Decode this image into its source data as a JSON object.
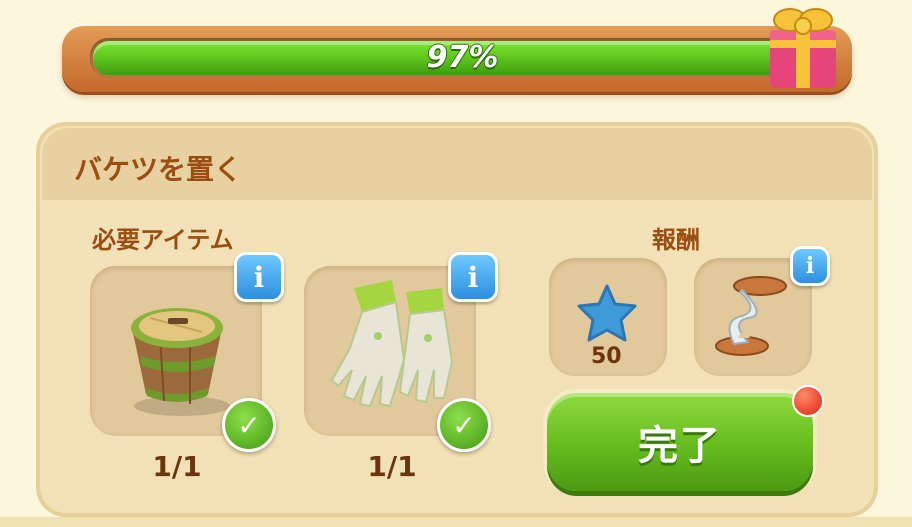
{
  "progress": {
    "percent_label": "97%",
    "fraction": 0.97
  },
  "quest": {
    "title": "バケツを置く"
  },
  "required": {
    "label": "必要アイテム",
    "items": [
      {
        "icon": "bucket-icon",
        "count": "1/1",
        "info": "i"
      },
      {
        "icon": "gloves-icon",
        "count": "1/1",
        "info": "i"
      }
    ]
  },
  "rewards": {
    "label": "報酬",
    "items": [
      {
        "icon": "blue-star-icon",
        "count": "50"
      },
      {
        "icon": "hourglass-icon",
        "info": "i"
      }
    ]
  },
  "complete_button": {
    "label": "完了"
  },
  "colors": {
    "accent_green": "#62b81c",
    "title_brown": "#9a4e12",
    "info_blue": "#2c8fe0"
  }
}
